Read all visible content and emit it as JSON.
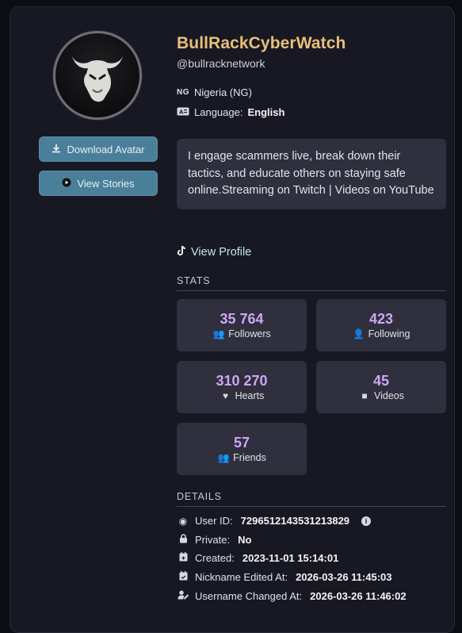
{
  "profile": {
    "display_name": "BullRackCyberWatch",
    "handle": "@bullracknetwork",
    "country_code": "NG",
    "country": "Nigeria (NG)",
    "language_label": "Language:",
    "language": "English",
    "bio": "I engage scammers live, break down their tactics, and educate others on staying safe online.Streaming on Twitch | Videos on YouTube",
    "view_profile_label": "View Profile"
  },
  "actions": {
    "download_avatar": "Download Avatar",
    "view_stories": "View Stories"
  },
  "stats": {
    "title": "STATS",
    "items": [
      {
        "value": "35 764",
        "label": "Followers",
        "icon": "users-icon"
      },
      {
        "value": "423",
        "label": "Following",
        "icon": "user-plus-icon"
      },
      {
        "value": "310 270",
        "label": "Hearts",
        "icon": "heart-icon"
      },
      {
        "value": "45",
        "label": "Videos",
        "icon": "video-icon"
      },
      {
        "value": "57",
        "label": "Friends",
        "icon": "user-friends-icon"
      }
    ]
  },
  "details": {
    "title": "DETAILS",
    "items": [
      {
        "label": "User ID:",
        "value": "7296512143531213829",
        "icon": "fingerprint-icon"
      },
      {
        "label": "Private:",
        "value": "No",
        "icon": "lock-icon"
      },
      {
        "label": "Created:",
        "value": "2023-11-01 15:14:01",
        "icon": "calendar-plus-icon"
      },
      {
        "label": "Nickname Edited At:",
        "value": "2026-03-26 11:45:03",
        "icon": "calendar-check-icon"
      },
      {
        "label": "Username Changed At:",
        "value": "2026-03-26 11:46:02",
        "icon": "user-edit-icon"
      }
    ]
  },
  "colors": {
    "accent_name": "#e8c07a",
    "stat_number": "#cfa6f4",
    "button": "#4a7f9a",
    "card_bg": "#181822",
    "panel_bg": "#2f2f3d"
  }
}
